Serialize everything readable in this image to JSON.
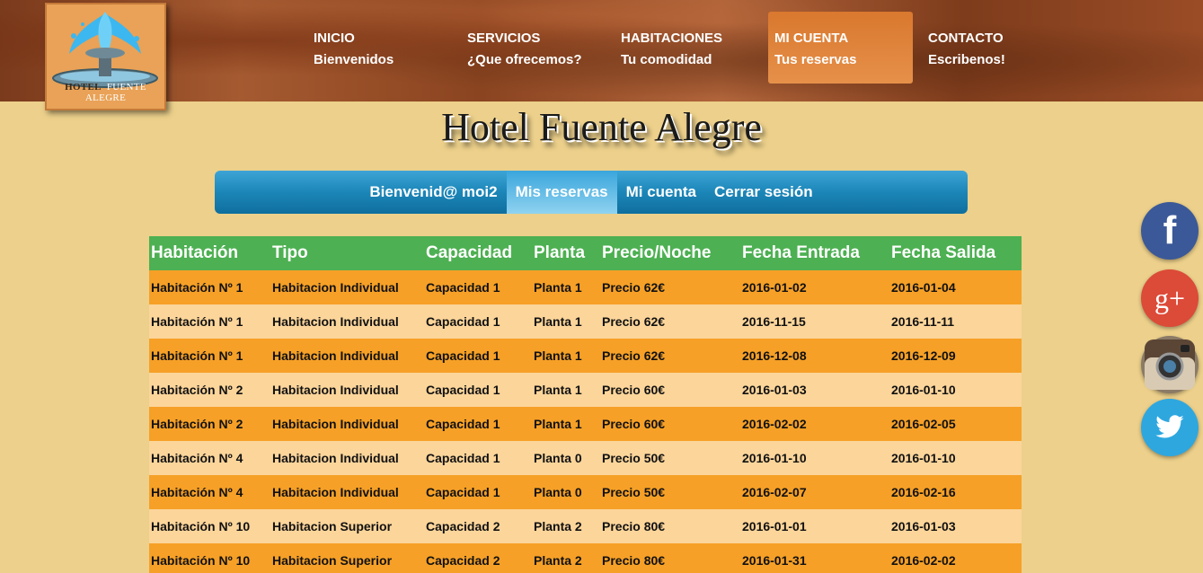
{
  "brand": {
    "logo_text_a": "HOTEL",
    "logo_text_b": "FUENTE ALEGRE",
    "site_title": "Hotel Fuente Alegre"
  },
  "nav": [
    {
      "title": "INICIO",
      "subtitle": "Bienvenidos",
      "active": false
    },
    {
      "title": "SERVICIOS",
      "subtitle": "¿Que ofrecemos?",
      "active": false
    },
    {
      "title": "HABITACIONES",
      "subtitle": "Tu comodidad",
      "active": false
    },
    {
      "title": "MI CUENTA",
      "subtitle": "Tus reservas",
      "active": true
    },
    {
      "title": "CONTACTO",
      "subtitle": "Escribenos!",
      "active": false
    }
  ],
  "subnav": {
    "welcome": "Bienvenid@ moi2",
    "reservas": "Mis reservas",
    "cuenta": "Mi cuenta",
    "logout": "Cerrar sesión"
  },
  "table": {
    "headers": [
      "Habitación",
      "Tipo",
      "Capacidad",
      "Planta",
      "Precio/Noche",
      "Fecha Entrada",
      "Fecha Salida"
    ],
    "rows": [
      [
        "Habitación Nº 1",
        "Habitacion Individual",
        "Capacidad 1",
        "Planta 1",
        "Precio 62€",
        "2016-01-02",
        "2016-01-04"
      ],
      [
        "Habitación Nº 1",
        "Habitacion Individual",
        "Capacidad 1",
        "Planta 1",
        "Precio 62€",
        "2016-11-15",
        "2016-11-11"
      ],
      [
        "Habitación Nº 1",
        "Habitacion Individual",
        "Capacidad 1",
        "Planta 1",
        "Precio 62€",
        "2016-12-08",
        "2016-12-09"
      ],
      [
        "Habitación Nº 2",
        "Habitacion Individual",
        "Capacidad 1",
        "Planta 1",
        "Precio 60€",
        "2016-01-03",
        "2016-01-10"
      ],
      [
        "Habitación Nº 2",
        "Habitacion Individual",
        "Capacidad 1",
        "Planta 1",
        "Precio 60€",
        "2016-02-02",
        "2016-02-05"
      ],
      [
        "Habitación Nº 4",
        "Habitacion Individual",
        "Capacidad 1",
        "Planta 0",
        "Precio 50€",
        "2016-01-10",
        "2016-01-10"
      ],
      [
        "Habitación Nº 4",
        "Habitacion Individual",
        "Capacidad 1",
        "Planta 0",
        "Precio 50€",
        "2016-02-07",
        "2016-02-16"
      ],
      [
        "Habitación Nº 10",
        "Habitacion Superior",
        "Capacidad 2",
        "Planta 2",
        "Precio 80€",
        "2016-01-01",
        "2016-01-03"
      ],
      [
        "Habitación Nº 10",
        "Habitacion Superior",
        "Capacidad 2",
        "Planta 2",
        "Precio 80€",
        "2016-01-31",
        "2016-02-02"
      ]
    ]
  },
  "social": [
    {
      "icon": "facebook-icon",
      "glyph": "f",
      "color": "#3b5998"
    },
    {
      "icon": "google-plus-icon",
      "glyph": "g+",
      "color": "#dc4a38"
    },
    {
      "icon": "instagram-icon",
      "glyph": "",
      "color": "#8a7a66"
    },
    {
      "icon": "twitter-icon",
      "glyph": "",
      "color": "#2ea7df"
    }
  ]
}
